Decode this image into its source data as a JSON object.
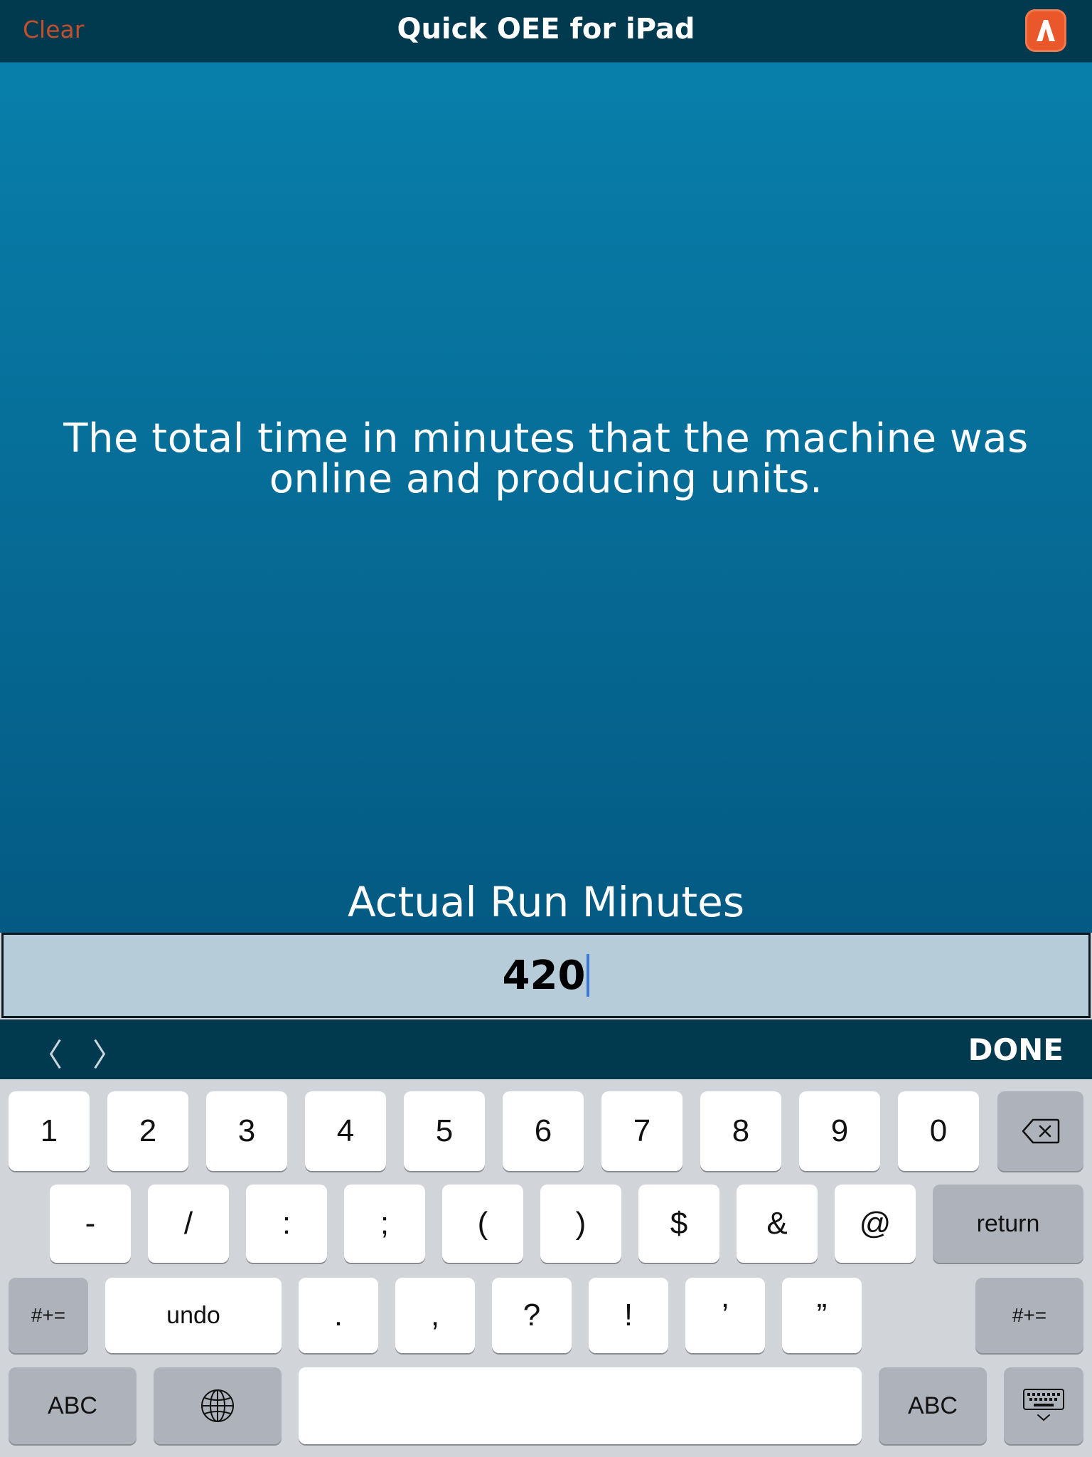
{
  "nav": {
    "clear_label": "Clear",
    "title": "Quick OEE for iPad",
    "logo_icon": "app-logo-icon"
  },
  "main": {
    "description": "The total time in minutes that the machine was online and producing units.",
    "field_label": "Actual Run Minutes",
    "field_value": "420"
  },
  "toolbar": {
    "prev": "〈",
    "next": "〉",
    "done": "DONE"
  },
  "keyboard": {
    "row1": [
      "1",
      "2",
      "3",
      "4",
      "5",
      "6",
      "7",
      "8",
      "9",
      "0"
    ],
    "row2": [
      "-",
      "/",
      ":",
      ";",
      "(",
      ")",
      "$",
      "&",
      "@"
    ],
    "return": "return",
    "symbols": "#+=",
    "undo": "undo",
    "row3": [
      ".",
      ",",
      "?",
      "!",
      "’",
      "”"
    ],
    "abc": "ABC",
    "globe_icon": "globe-icon",
    "delete_icon": "delete-icon",
    "dismiss_icon": "keyboard-dismiss-icon"
  },
  "colors": {
    "navbar": "#01394f",
    "accent": "#c2502c",
    "logo": "#e9572a",
    "input": "#b6ccd8"
  }
}
